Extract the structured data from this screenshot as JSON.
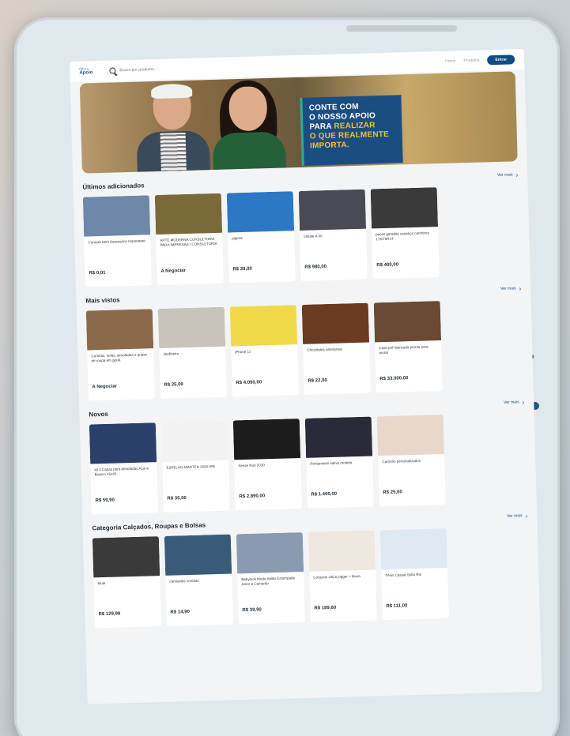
{
  "navbar": {
    "logo_top": "Olha o",
    "logo_main": "Apoio",
    "search_placeholder": "Busca por produtos...",
    "nav_home": "Home",
    "nav_products": "Produtos",
    "enter_label": "Entrar"
  },
  "banner": {
    "line1": "CONTE COM",
    "line2": "O NOSSO APOIO",
    "line3a": "PARA",
    "line3b": "REALIZAR",
    "line4": "O QUE REALMENTE",
    "line5": "IMPORTA."
  },
  "colors": {
    "brand": "#0f4c81",
    "accent": "#f2c12e"
  },
  "sections": [
    {
      "title": "Últimos adicionados",
      "see_more": "Ver mais",
      "items": [
        {
          "title": "Console bem Assessório Importante",
          "price": "R$ 0,01",
          "thumb": "#6f88a8"
        },
        {
          "title": "ARTE MODERNA CONSULTORIA PARA IMPRESAS / CONSULTORIA",
          "price": "A Negociar",
          "thumb": "#7a6a3a"
        },
        {
          "title": "pijama",
          "price": "R$ 39,00",
          "thumb": "#2d78c4"
        },
        {
          "title": "celular A 30",
          "price": "R$ 980,00",
          "thumb": "#4a4a55"
        },
        {
          "title": "peças geradas usuarios carrinhos 175/75R14",
          "price": "R$ 400,00",
          "thumb": "#3a3a3a"
        }
      ]
    },
    {
      "title": "Mais vistos",
      "see_more": "Ver mais",
      "items": [
        {
          "title": "Cortinas, sofás, almofadas e quase de roupa em geral.",
          "price": "A Negociar",
          "thumb": "#8a6a4a"
        },
        {
          "title": "Jardineiro",
          "price": "R$ 25,00",
          "thumb": "#c8c4bc"
        },
        {
          "title": "iPhone 11",
          "price": "R$ 4.090,00",
          "thumb": "#f0d84a"
        },
        {
          "title": "Chocolates artesanais",
          "price": "R$ 22,00",
          "thumb": "#6a3a22"
        },
        {
          "title": "Casa pré fabricada pronta para morar",
          "price": "R$ 33.000,00",
          "thumb": "#6a4a32"
        }
      ]
    },
    {
      "title": "Novos",
      "see_more": "Ver mais",
      "items": [
        {
          "title": "kit 3 Capas para Almofadas Azul e Branco 45x45",
          "price": "R$ 59,90",
          "thumb": "#2a3f6a"
        },
        {
          "title": "ESPELHO MARTEN 2000-095",
          "price": "R$ 35,00",
          "thumb": "#f2f2f2"
        },
        {
          "title": "Sense Run 2030",
          "price": "R$ 2.890,00",
          "thumb": "#1c1c1c"
        },
        {
          "title": "Pertiannieto saliva modela",
          "price": "R$ 1.400,00",
          "thumb": "#2a2a3a"
        },
        {
          "title": "Carrinho personalizados",
          "price": "R$ 25,00",
          "thumb": "#e8d8cc"
        }
      ]
    },
    {
      "title": "Categoria Calçados, Roupas e Bolsas",
      "see_more": "Ver mais",
      "items": [
        {
          "title": "Mule",
          "price": "R$ 129,99",
          "thumb": "#3a3a3a"
        },
        {
          "title": "camisetas sortidas",
          "price": "R$ 14,90",
          "thumb": "#3a5a7a"
        },
        {
          "title": "Babylook Moda Aeião Estampada Amor a Camarão",
          "price": "R$ 39,90",
          "thumb": "#8a9ab0"
        },
        {
          "title": "Conjunto calça jogger + blusa",
          "price": "R$ 189,60",
          "thumb": "#efe8e0"
        },
        {
          "title": "Tênis Casual Solto Rio",
          "price": "R$ 111,00",
          "thumb": "#dfe9f2"
        }
      ]
    }
  ]
}
